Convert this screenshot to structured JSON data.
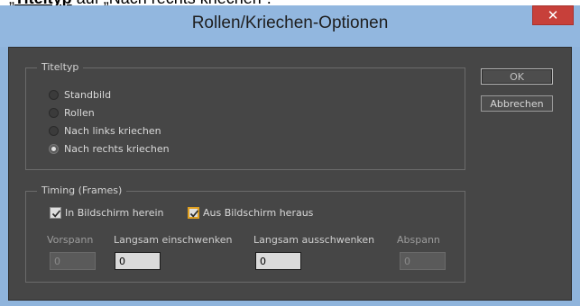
{
  "caption": {
    "bold": "Titeltyp",
    "rest": " auf „Nach rechts kriechen“."
  },
  "window": {
    "title": "Rollen/Kriechen-Optionen",
    "close_label": "✕"
  },
  "titeltyp": {
    "legend": "Titeltyp",
    "options": [
      {
        "label": "Standbild",
        "checked": false
      },
      {
        "label": "Rollen",
        "checked": false
      },
      {
        "label": "Nach links kriechen",
        "checked": false
      },
      {
        "label": "Nach rechts kriechen",
        "checked": true
      }
    ]
  },
  "timing": {
    "legend": "Timing (Frames)",
    "in_bildschirm": {
      "label": "In Bildschirm herein",
      "checked": true
    },
    "aus_bildschirm": {
      "label": "Aus Bildschirm heraus",
      "checked": true
    },
    "fields": {
      "vorspann": {
        "label": "Vorspann",
        "value": "0",
        "enabled": false
      },
      "langsam_ein": {
        "label": "Langsam einschwenken",
        "value": "0",
        "enabled": true
      },
      "langsam_aus": {
        "label": "Langsam ausschwenken",
        "value": "0",
        "enabled": true
      },
      "abspann": {
        "label": "Abspann",
        "value": "0",
        "enabled": false
      }
    }
  },
  "buttons": {
    "ok": "OK",
    "cancel": "Abbrechen"
  }
}
